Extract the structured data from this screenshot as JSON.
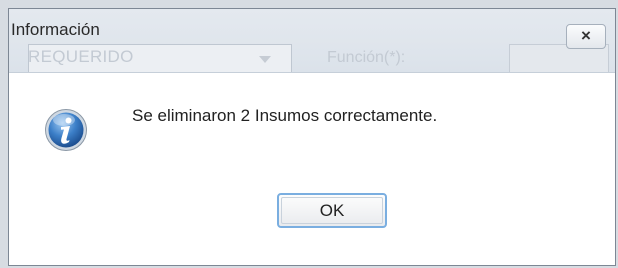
{
  "dialog": {
    "title": "Información",
    "close_label": "×",
    "message": "Se eliminaron 2 Insumos correctamente.",
    "ok_label": "OK",
    "icon": "info-icon"
  },
  "background_form": {
    "select_value": "REQUERIDO",
    "funcion_label": "Función(*):"
  },
  "colors": {
    "titlebar": "#dfe5ec",
    "dialog_border": "#7d8794",
    "ok_focus_border": "#7aaee0",
    "icon_blue": "#2f6fb8"
  }
}
